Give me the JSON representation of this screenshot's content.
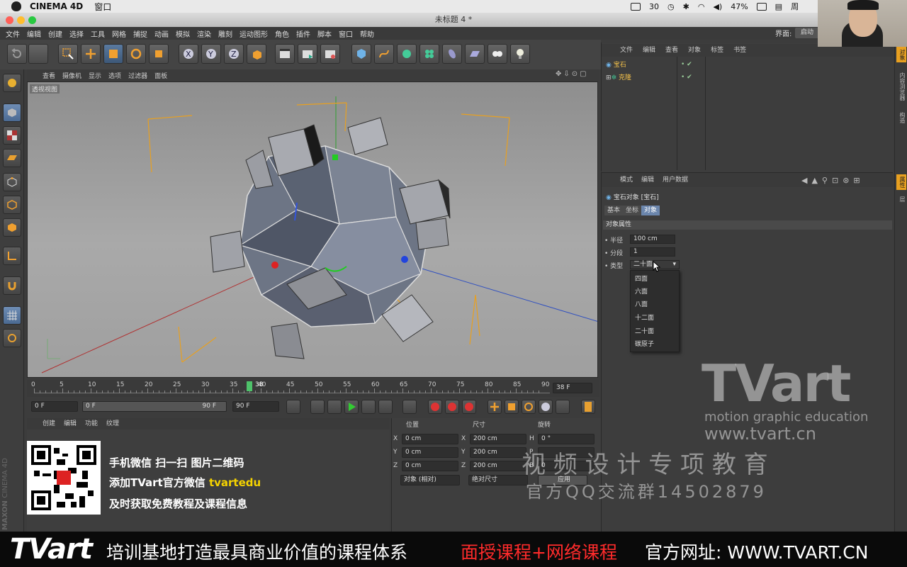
{
  "macmenu": {
    "app": "CINEMA 4D",
    "window": "窗口",
    "battery": "47%",
    "count": "30",
    "day": "周"
  },
  "window": {
    "title": "未标题 4 *"
  },
  "menu": {
    "items": [
      "文件",
      "编辑",
      "创建",
      "选择",
      "工具",
      "网格",
      "捕捉",
      "动画",
      "模拟",
      "渲染",
      "雕刻",
      "运动图形",
      "角色",
      "插件",
      "脚本",
      "窗口",
      "帮助"
    ],
    "layout_label": "界面:",
    "layout_value": "启动"
  },
  "viewport": {
    "menu": [
      "查看",
      "摄像机",
      "显示",
      "选项",
      "过滤器",
      "面板"
    ],
    "label": "透视视图"
  },
  "timeline": {
    "ticks": [
      "0",
      "5",
      "10",
      "15",
      "20",
      "25",
      "30",
      "35",
      "40",
      "45",
      "50",
      "55",
      "60",
      "65",
      "70",
      "75",
      "80",
      "85",
      "90"
    ],
    "current": "38",
    "current_field": "38 F"
  },
  "playback": {
    "start": "0 F",
    "range_start": "0 F",
    "range_end": "90 F",
    "end": "90 F"
  },
  "material": {
    "menu": [
      "创建",
      "编辑",
      "功能",
      "纹理"
    ]
  },
  "coords": {
    "headers": {
      "position": "位置",
      "size": "尺寸",
      "rotation": "旋转"
    },
    "rows": [
      {
        "axis": "X",
        "pos": "0 cm",
        "saxis": "X",
        "size": "200 cm",
        "raxis": "H",
        "rot": "0 °"
      },
      {
        "axis": "Y",
        "pos": "0 cm",
        "saxis": "Y",
        "size": "200 cm",
        "raxis": "P",
        "rot": ""
      },
      {
        "axis": "Z",
        "pos": "0 cm",
        "saxis": "Z",
        "size": "200 cm",
        "raxis": "B",
        "rot": "0"
      }
    ],
    "mode1": "对象 (相对)",
    "mode2": "绝对尺寸",
    "apply": "应用"
  },
  "objects": {
    "menu": [
      "文件",
      "编辑",
      "查看",
      "对象",
      "标签",
      "书签"
    ],
    "items": [
      "宝石",
      "克隆"
    ]
  },
  "attributes": {
    "menu": [
      "模式",
      "编辑",
      "用户数据"
    ],
    "object_title": "宝石对象 [宝石]",
    "tabs": [
      "基本",
      "坐标",
      "对象"
    ],
    "section": "对象属性",
    "params": [
      {
        "label": "半径",
        "value": "100 cm"
      },
      {
        "label": "分段",
        "value": "1"
      },
      {
        "label": "类型",
        "value": "二十面"
      }
    ],
    "type_options": [
      "四面",
      "六面",
      "八面",
      "十二面",
      "二十面",
      "碳原子"
    ]
  },
  "side_tabs": [
    "对象",
    "内容浏览器",
    "构造"
  ],
  "side_tabs2": [
    "属性",
    "层"
  ],
  "promo": {
    "line1": "手机微信  扫一扫  图片二维码",
    "line2a": "添加TVart官方微信 ",
    "line2b": "tvartedu",
    "line3": "及时获取免费教程及课程信息"
  },
  "watermark": {
    "brand": "TVart",
    "tagline": "motion graphic education",
    "url": "www.tvart.cn",
    "cn": "视 频 设 计 专 项 教 育",
    "qq": "官方QQ交流群14502879"
  },
  "footer": {
    "brand": "TVart",
    "text1": "培训基地打造最具商业价值的课程体系",
    "text2": "面授课程+网络课程",
    "text3": "官方网址: WWW.TVART.CN"
  },
  "maxon": {
    "line1": "MAXON",
    "line2": "CINEMA 4D"
  },
  "colors": {
    "accent": "#6b86ad",
    "footer_red": "#ff2b2b",
    "promo_yellow": "#f5d300",
    "object_orange": "#f2c04a"
  }
}
